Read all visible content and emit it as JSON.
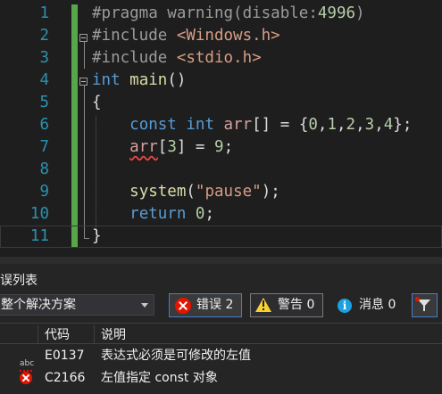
{
  "editor": {
    "line_numbers": [
      "1",
      "2",
      "3",
      "4",
      "5",
      "6",
      "7",
      "8",
      "9",
      "10",
      "11"
    ],
    "lines": [
      [
        {
          "t": "#pragma warning(disable:",
          "c": "pp"
        },
        {
          "t": "4996",
          "c": "num"
        },
        {
          "t": ")",
          "c": "pp"
        }
      ],
      [
        {
          "t": "#include ",
          "c": "pp"
        },
        {
          "t": "<Windows.h>",
          "c": "str"
        }
      ],
      [
        {
          "t": "#include ",
          "c": "pp"
        },
        {
          "t": "<stdio.h>",
          "c": "str"
        }
      ],
      [
        {
          "t": "int ",
          "c": "kw"
        },
        {
          "t": "main",
          "c": "fn"
        },
        {
          "t": "()",
          "c": ""
        }
      ],
      [
        {
          "t": "{",
          "c": ""
        }
      ],
      [
        {
          "t": "    ",
          "c": ""
        },
        {
          "t": "const ",
          "c": "kw"
        },
        {
          "t": "int ",
          "c": "kw"
        },
        {
          "t": "arr",
          "c": "ref"
        },
        {
          "t": "[] = {",
          "c": ""
        },
        {
          "t": "0",
          "c": "num"
        },
        {
          "t": ",",
          "c": ""
        },
        {
          "t": "1",
          "c": "num"
        },
        {
          "t": ",",
          "c": ""
        },
        {
          "t": "2",
          "c": "num"
        },
        {
          "t": ",",
          "c": ""
        },
        {
          "t": "3",
          "c": "num"
        },
        {
          "t": ",",
          "c": ""
        },
        {
          "t": "4",
          "c": "num"
        },
        {
          "t": "};",
          "c": ""
        }
      ],
      [
        {
          "t": "    ",
          "c": ""
        },
        {
          "t": "arr",
          "c": "ref squig"
        },
        {
          "t": "[",
          "c": ""
        },
        {
          "t": "3",
          "c": "num"
        },
        {
          "t": "] = ",
          "c": ""
        },
        {
          "t": "9",
          "c": "num"
        },
        {
          "t": ";",
          "c": ""
        }
      ],
      [],
      [
        {
          "t": "    ",
          "c": ""
        },
        {
          "t": "system",
          "c": "fn"
        },
        {
          "t": "(",
          "c": ""
        },
        {
          "t": "\"pause\"",
          "c": "str"
        },
        {
          "t": ");",
          "c": ""
        }
      ],
      [
        {
          "t": "    ",
          "c": ""
        },
        {
          "t": "return ",
          "c": "kw"
        },
        {
          "t": "0",
          "c": "num"
        },
        {
          "t": ";",
          "c": ""
        }
      ],
      [
        {
          "t": "}",
          "c": ""
        }
      ]
    ]
  },
  "error_list": {
    "title": "误列表",
    "scope": "整个解决方案",
    "errors_label": "错误 2",
    "warnings_label": "警告 0",
    "messages_label": "消息 0",
    "columns": {
      "code": "代码",
      "description": "说明"
    },
    "rows": [
      {
        "icon": "spell-error-icon",
        "code": "E0137",
        "description": "表达式必须是可修改的左值"
      },
      {
        "icon": "error-icon",
        "code": "C2166",
        "description": "左值指定 const 对象"
      }
    ]
  },
  "colors": {
    "editor_bg": "#1e1e1e",
    "line_number": "#2b91af",
    "change_bar": "#57a64a",
    "keyword": "#569cd6",
    "string": "#d69d85",
    "number": "#b5cea8",
    "error": "#e51400",
    "warning": "#f8d030",
    "info": "#1ba1e2"
  }
}
